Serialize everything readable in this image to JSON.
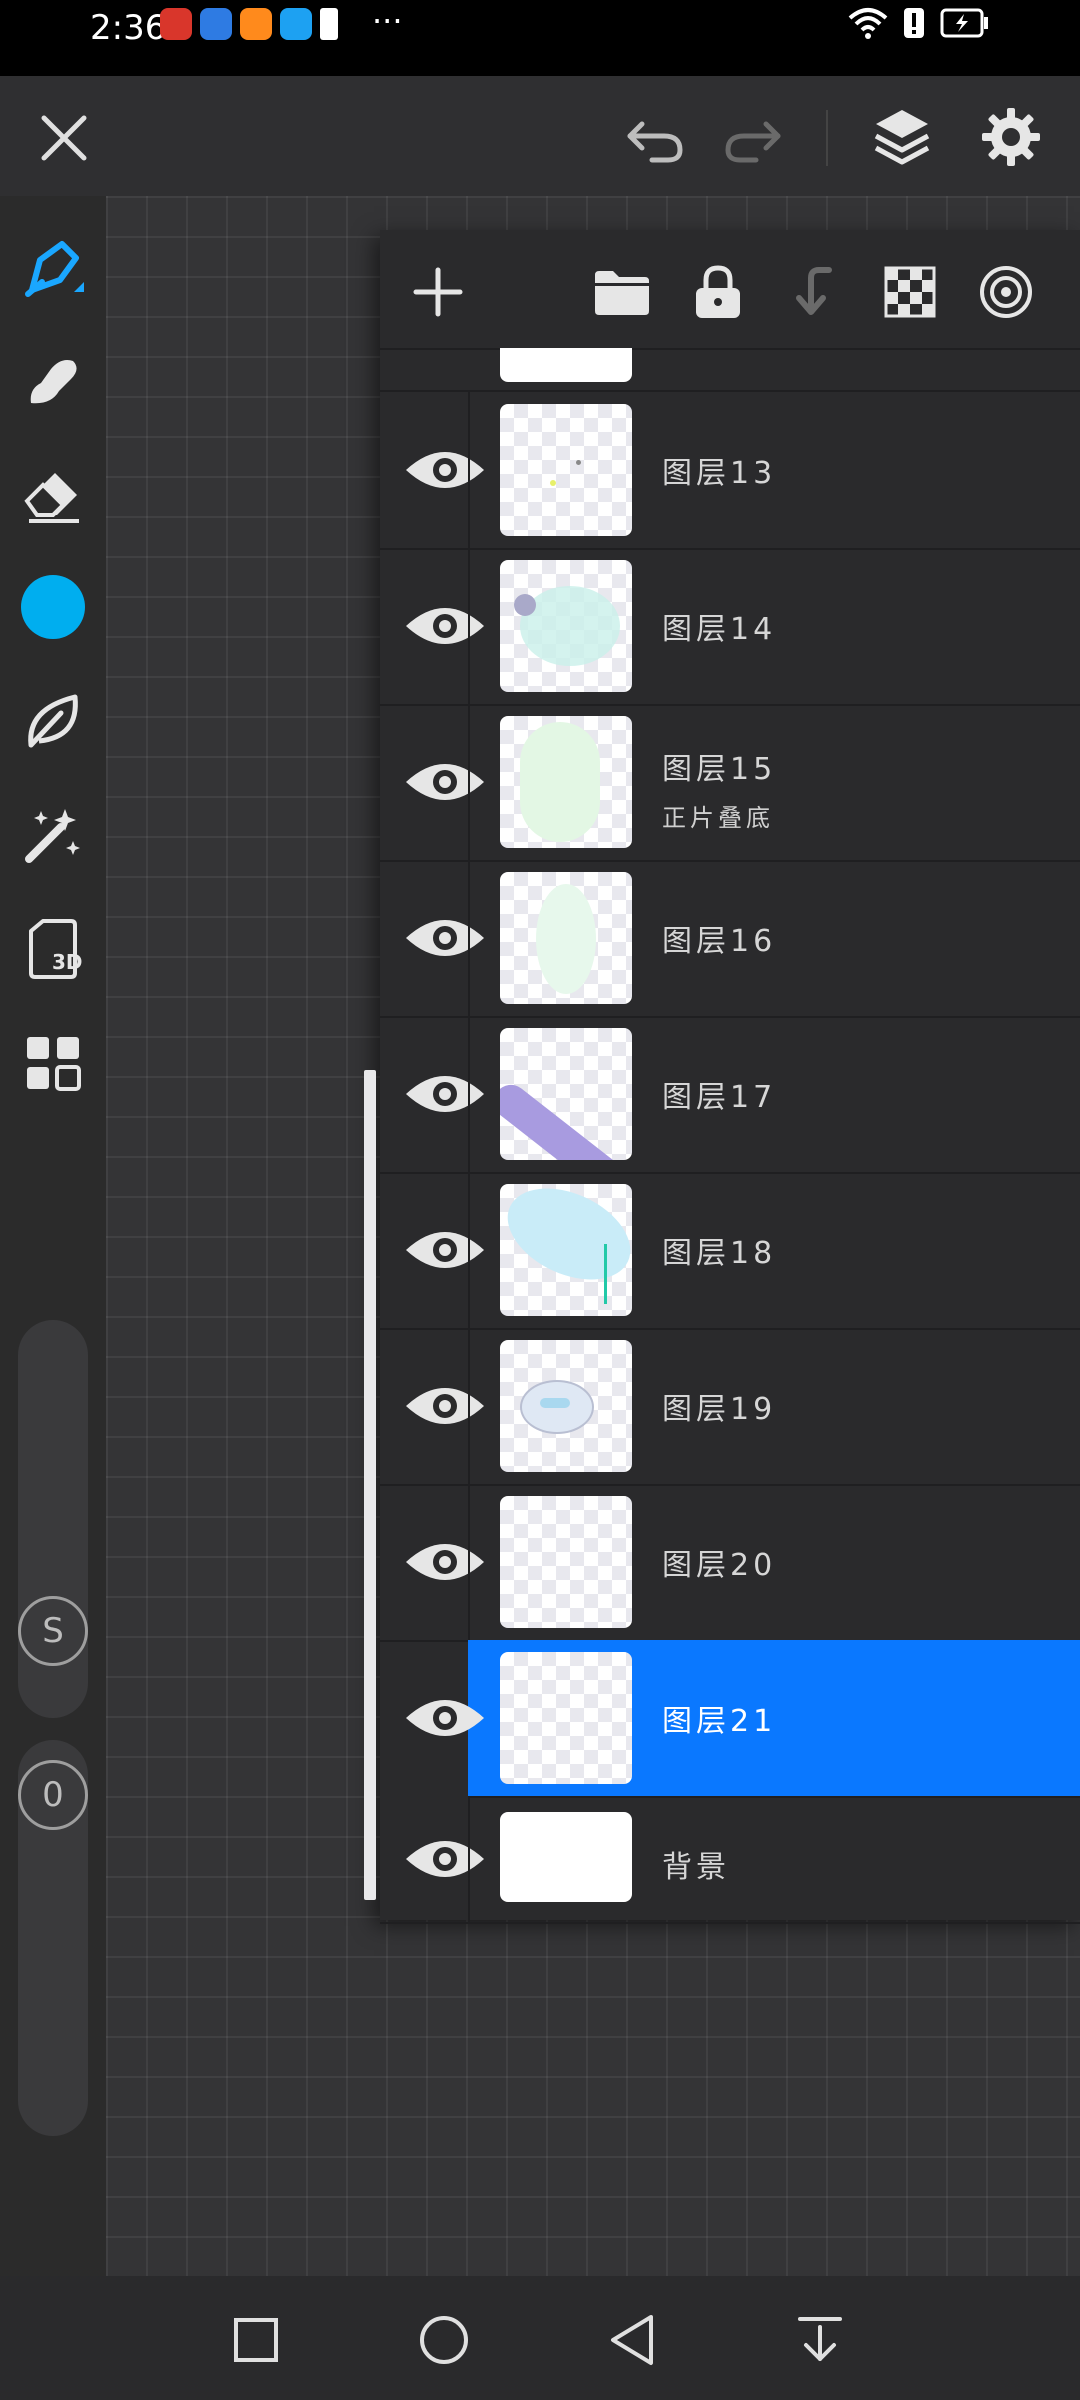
{
  "status_bar": {
    "time": "2:36",
    "more": "···",
    "app_icons": [
      "red-app-icon",
      "blue-globe-icon",
      "orange-play-icon",
      "blue-search-icon",
      "exclamation-icon"
    ],
    "right_icons": [
      "wifi-icon",
      "alert-icon",
      "battery-charging-icon"
    ]
  },
  "toolbar": {
    "icons": [
      "close-icon",
      "undo-icon",
      "redo-icon",
      "layers-icon",
      "gear-icon"
    ]
  },
  "left_rail": {
    "tools": [
      "brush-icon",
      "smudge-icon",
      "eraser-icon",
      "color-swatch",
      "leaf-icon",
      "magic-wand-icon",
      "3d-file-icon",
      "grid-apps-icon"
    ],
    "color": "#00AEEF",
    "file_badge": "3D",
    "size_label": "S",
    "opacity_label": "0"
  },
  "layers_panel": {
    "header_icons": [
      "add-icon",
      "folder-icon",
      "lock-icon",
      "merge-down-icon",
      "checker-icon",
      "target-icon"
    ],
    "layers": [
      {
        "name": "图层13",
        "blend": "",
        "active": false
      },
      {
        "name": "图层14",
        "blend": "",
        "active": false
      },
      {
        "name": "图层15",
        "blend": "正片叠底",
        "active": false
      },
      {
        "name": "图层16",
        "blend": "",
        "active": false
      },
      {
        "name": "图层17",
        "blend": "",
        "active": false
      },
      {
        "name": "图层18",
        "blend": "",
        "active": false
      },
      {
        "name": "图层19",
        "blend": "",
        "active": false
      },
      {
        "name": "图层20",
        "blend": "",
        "active": false
      },
      {
        "name": "图层21",
        "blend": "",
        "active": true
      },
      {
        "name": "背景",
        "blend": "",
        "active": false
      }
    ],
    "accent_color": "#0A78FF"
  },
  "nav_bar": {
    "buttons": [
      "recent-apps-icon",
      "home-icon",
      "back-icon",
      "notification-shade-icon"
    ]
  }
}
